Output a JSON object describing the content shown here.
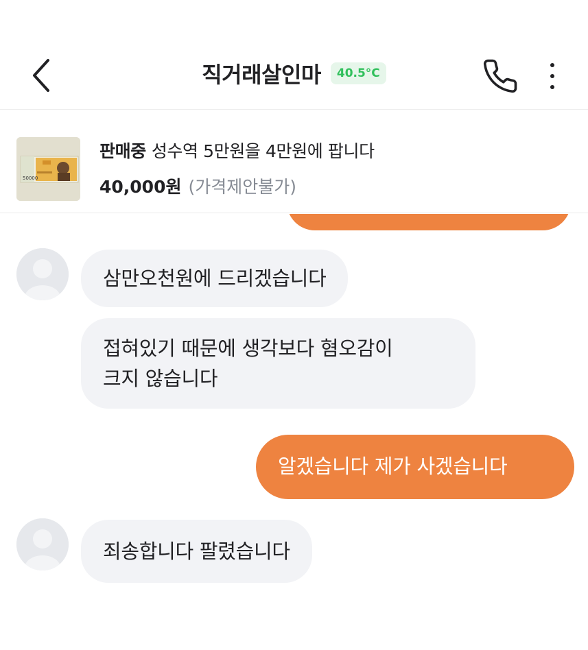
{
  "header": {
    "title": "직거래살인마",
    "temperature": "40.5°C"
  },
  "product": {
    "status": "판매중",
    "title": "성수역 5만원을 4만원에 팝니다",
    "price": "40,000원",
    "price_note": "(가격제안불가)",
    "thumbnail": {
      "banknote_label": "50000"
    }
  },
  "messages": [
    {
      "side": "out",
      "text": ""
    },
    {
      "side": "in",
      "text": "삼만오천원에 드리겠습니다"
    },
    {
      "side": "in",
      "lines": [
        "접혀있기 때문에 생각보다 혐오감이",
        "크지 않습니다"
      ]
    },
    {
      "side": "out",
      "text": "알겠습니다 제가 사겠습니다"
    },
    {
      "side": "in",
      "text": "죄송합니다 팔렸습니다"
    }
  ],
  "colors": {
    "accent_orange": "#ee8340",
    "incoming_bubble": "#f2f3f6",
    "temperature_green": "#31c05c"
  }
}
